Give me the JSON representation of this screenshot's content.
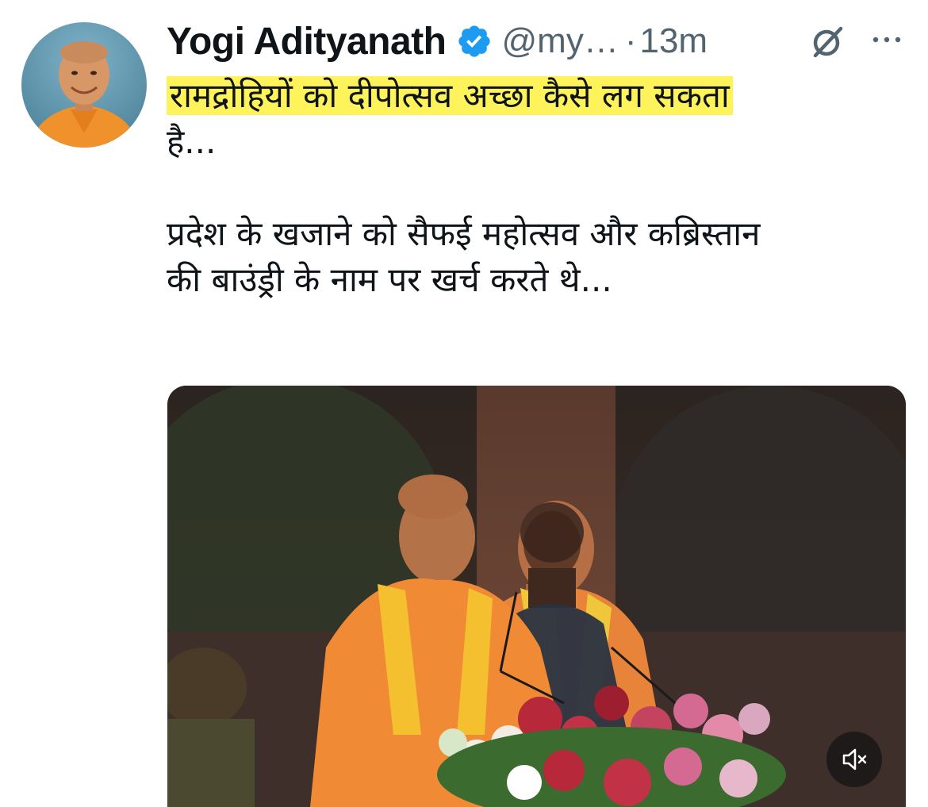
{
  "tweet": {
    "author": {
      "display_name": "Yogi Adityanath",
      "handle": "@my…",
      "verified": true,
      "avatar_icon": "avatar-photo"
    },
    "separator": "·",
    "timestamp": "13m",
    "text": {
      "highlighted_line": "रामद्रोहियों को दीपोत्सव अच्छा कैसे लग सकता",
      "line_2": "है...",
      "paragraph_2_line_1": "प्रदेश के खजाने को सैफई महोत्सव और कब्रिस्तान",
      "paragraph_2_line_2": "की बाउंड्री के नाम पर खर्च करते थे..."
    },
    "media": {
      "type": "video",
      "mute_icon": "speaker-muted-icon"
    }
  },
  "colors": {
    "text": "#0f1419",
    "secondary": "#536471",
    "verified_blue": "#1d9bf0",
    "highlight": "#fff35c"
  }
}
